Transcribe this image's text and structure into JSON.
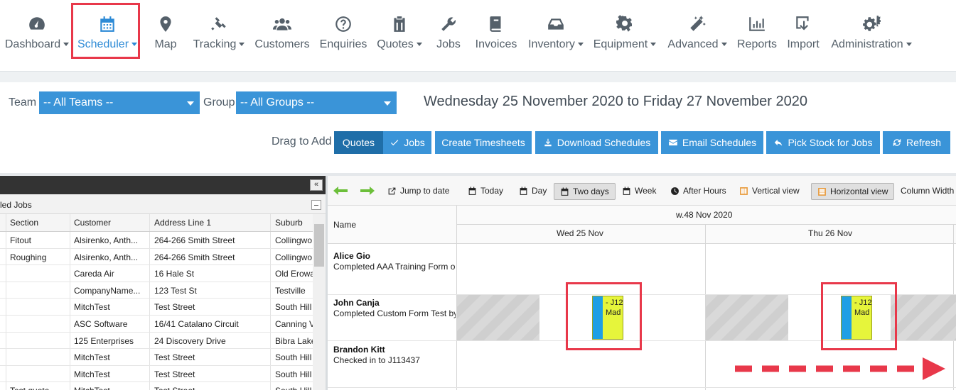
{
  "nav": {
    "items": [
      {
        "label": "Dashboard",
        "icon": "dashboard-icon",
        "caret": true
      },
      {
        "label": "Scheduler",
        "icon": "calendar-icon",
        "caret": true,
        "active": true
      },
      {
        "label": "Map",
        "icon": "map-pin-icon",
        "caret": false
      },
      {
        "label": "Tracking",
        "icon": "satellite-icon",
        "caret": true
      },
      {
        "label": "Customers",
        "icon": "users-icon",
        "caret": false
      },
      {
        "label": "Enquiries",
        "icon": "question-icon",
        "caret": false
      },
      {
        "label": "Quotes",
        "icon": "clipboard-icon",
        "caret": true
      },
      {
        "label": "Jobs",
        "icon": "wrench-icon",
        "caret": false
      },
      {
        "label": "Invoices",
        "icon": "book-icon",
        "caret": false
      },
      {
        "label": "Inventory",
        "icon": "inbox-icon",
        "caret": true
      },
      {
        "label": "Equipment",
        "icon": "gear-icon",
        "caret": true
      },
      {
        "label": "Advanced",
        "icon": "magic-wand-icon",
        "caret": true
      },
      {
        "label": "Reports",
        "icon": "bar-chart-icon",
        "caret": false
      },
      {
        "label": "Import",
        "icon": "import-icon",
        "caret": false
      },
      {
        "label": "Administration",
        "icon": "gears-icon",
        "caret": true
      }
    ]
  },
  "filters": {
    "team_label": "Team",
    "team_value": "-- All Teams --",
    "group_label": "Group",
    "group_value": "-- All Groups --",
    "date_range": "Wednesday 25 November 2020 to Friday 27 November 2020",
    "drag_to_add": "Drag to Add",
    "quotes_btn": "Quotes",
    "jobs_btn": "Jobs",
    "create_timesheets": "Create Timesheets",
    "download_schedules": "Download Schedules",
    "email_schedules": "Email Schedules",
    "pick_stock": "Pick Stock for Jobs",
    "refresh": "Refresh"
  },
  "left_panel": {
    "title": "led Jobs",
    "collapse_icon": "double-chevron-left-icon",
    "columns": [
      "Section",
      "Customer",
      "Address Line 1",
      "Suburb"
    ],
    "rows": [
      [
        "Fitout",
        "Alsirenko, Anth...",
        "264-266 Smith Street",
        "Collingwo"
      ],
      [
        "Roughing",
        "Alsirenko, Anth...",
        "264-266 Smith Street",
        "Collingwo"
      ],
      [
        "",
        "Careda Air",
        "16 Hale St",
        "Old Erowa"
      ],
      [
        "",
        "CompanyName...",
        "123 Test St",
        "Testville"
      ],
      [
        "",
        "MitchTest",
        "Test Street",
        "South Hill"
      ],
      [
        "",
        "ASC Software",
        "16/41 Catalano Circuit",
        "Canning V"
      ],
      [
        "",
        "125 Enterprises",
        "24 Discovery Drive",
        "Bibra Lake"
      ],
      [
        "",
        "MitchTest",
        "Test Street",
        "South Hill"
      ],
      [
        "",
        "MitchTest",
        "Test Street",
        "South Hill"
      ],
      [
        "Test quote",
        "MitchTest",
        "Test Street",
        "South Hill"
      ]
    ]
  },
  "scheduler": {
    "toolbar": {
      "jump_to_date": "Jump to date",
      "today": "Today",
      "day": "Day",
      "two_days": "Two days",
      "week": "Week",
      "after_hours": "After Hours",
      "vertical_view": "Vertical view",
      "horizontal_view": "Horizontal view",
      "column_width": "Column Width"
    },
    "name_header": "Name",
    "week_label": "w.48 Nov 2020",
    "days": [
      "Wed 25 Nov",
      "Thu 26 Nov"
    ],
    "resources": [
      {
        "name": "Alice Gio",
        "status": "Completed AAA Training Form on"
      },
      {
        "name": "John Canja",
        "status": "Completed Custom Form Test by"
      },
      {
        "name": "Brandon Kitt",
        "status": "Checked in to J113437"
      }
    ],
    "events": [
      {
        "line1": "- J12",
        "line2": "Mad"
      },
      {
        "line1": "- J12",
        "line2": "Mad"
      }
    ]
  }
}
